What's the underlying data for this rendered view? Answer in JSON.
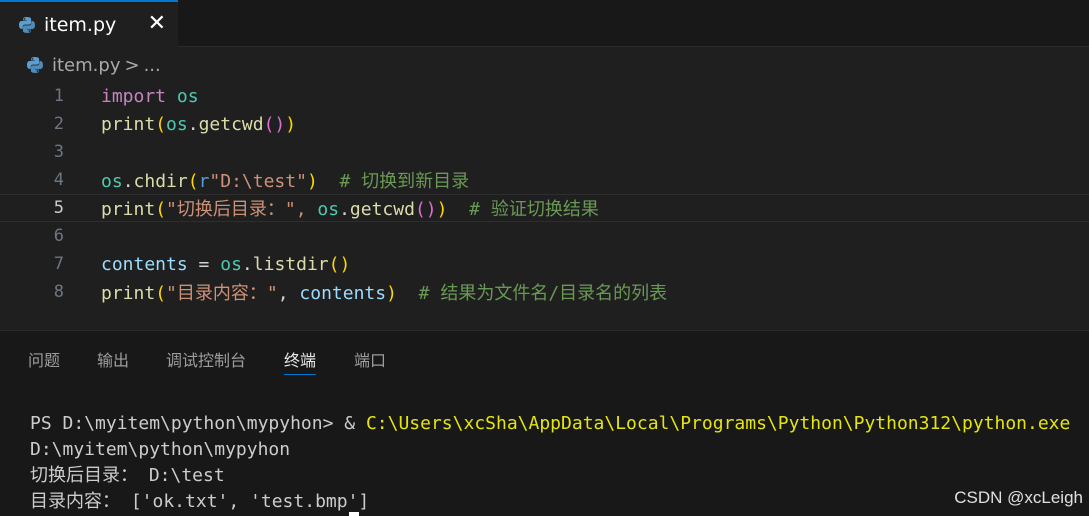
{
  "tab": {
    "label": "item.py",
    "close": "✕",
    "icon": "python-icon"
  },
  "breadcrumb": {
    "file": "item.py",
    "separator": ">",
    "more": "..."
  },
  "editor": {
    "line_numbers": [
      "1",
      "2",
      "3",
      "4",
      "5",
      "6",
      "7",
      "8"
    ],
    "active_line": "5"
  },
  "panel": {
    "tabs": [
      "问题",
      "输出",
      "调试控制台",
      "终端",
      "端口"
    ],
    "active_tab": "终端"
  },
  "terminal": {
    "prompt": "PS D:\\myitem\\python\\mypyhon> & ",
    "exe_path": "C:\\Users\\xcSha\\AppData\\Local\\Programs\\Python\\Python312\\python.exe",
    "lines": [
      "D:\\myitem\\python\\mypyhon",
      "切换后目录： D:\\test",
      "目录内容： ['ok.txt', 'test.bmp']"
    ]
  },
  "watermark": "CSDN @xcLeigh",
  "colors": {
    "accent": "#0078d4",
    "background": "#1f1f1f",
    "panel": "#181818"
  }
}
